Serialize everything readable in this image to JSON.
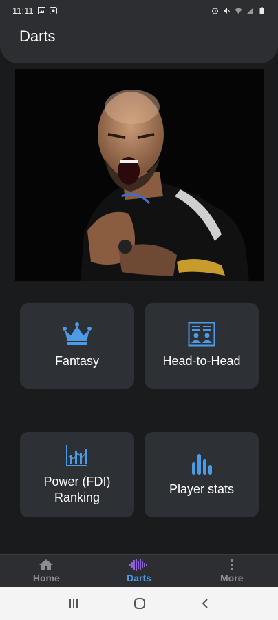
{
  "status_bar": {
    "time": "11:11",
    "icons_left": [
      "image-icon",
      "notification-icon"
    ],
    "icons_right": [
      "alarm-icon",
      "mute-icon",
      "wifi-icon",
      "signal-icon",
      "battery-icon"
    ]
  },
  "header": {
    "title": "Darts"
  },
  "hero": {
    "image": "player-celebrating-photo"
  },
  "cards": {
    "fantasy": {
      "label": "Fantasy",
      "icon": "crown-icon"
    },
    "head_to_head": {
      "label": "Head-to-Head",
      "icon": "head-to-head-icon"
    },
    "power_ranking": {
      "label": "Power (FDI) Ranking",
      "icon": "ranking-chart-icon"
    },
    "player_stats": {
      "label": "Player stats",
      "icon": "bar-chart-icon"
    }
  },
  "colors": {
    "accent": "#4d9be6",
    "card": "#2d3034",
    "background": "#1a1b1d"
  },
  "bottom_nav": {
    "items": [
      {
        "label": "Home",
        "icon": "home-icon",
        "active": false
      },
      {
        "label": "Darts",
        "icon": "darts-icon",
        "active": true
      },
      {
        "label": "More",
        "icon": "more-vertical-icon",
        "active": false
      }
    ]
  },
  "system_nav": [
    "recents-button",
    "home-button",
    "back-button"
  ]
}
